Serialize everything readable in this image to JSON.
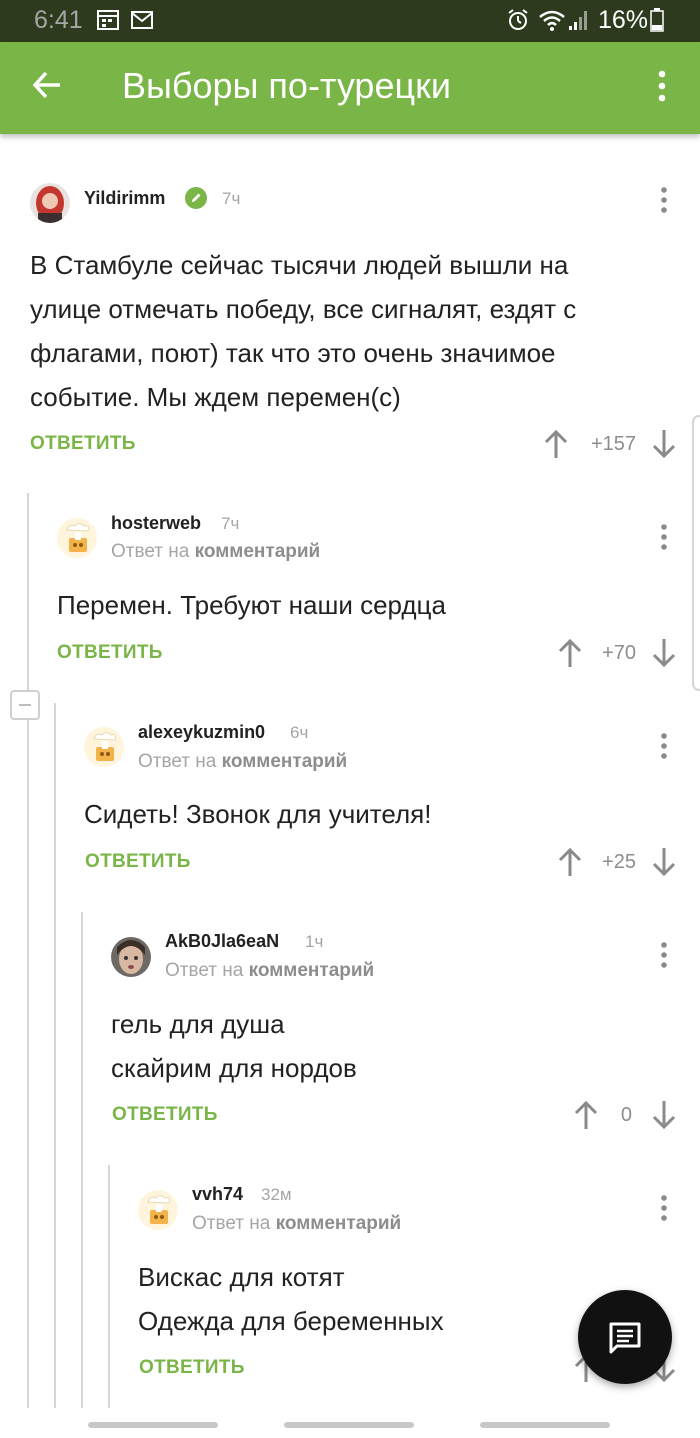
{
  "status_bar": {
    "time": "6:41",
    "battery": "16%"
  },
  "app_bar": {
    "title": "Выборы по-турецки"
  },
  "comments": [
    {
      "author": "Yildirimm",
      "time": "7ч",
      "verified": true,
      "reply_to": null,
      "text": [
        "В Стамбуле сейчас тысячи людей вышли на",
        "улице отмечать победу, все сигналят, ездят с",
        "флагами, поют) так что это очень значимое",
        "событие. Мы ждем перемен(с)"
      ],
      "reply_label": "ОТВЕТИТЬ",
      "score": "+157"
    },
    {
      "author": "hosterweb",
      "time": "7ч",
      "reply_prefix": "Ответ на",
      "reply_target": "комментарий",
      "text": [
        "Перемен. Требуют наши сердца"
      ],
      "reply_label": "ОТВЕТИТЬ",
      "score": "+70"
    },
    {
      "author": "alexeykuzmin0",
      "time": "6ч",
      "reply_prefix": "Ответ на",
      "reply_target": "комментарий",
      "text": [
        "Сидеть! Звонок для учителя!"
      ],
      "reply_label": "ОТВЕТИТЬ",
      "score": "+25"
    },
    {
      "author": "AkB0Jla6eaN",
      "time": "1ч",
      "reply_prefix": "Ответ на",
      "reply_target": "комментарий",
      "text": [
        "гель для душа",
        "скайрим для нордов"
      ],
      "reply_label": "ОТВЕТИТЬ",
      "score": "0"
    },
    {
      "author": "vvh74",
      "time": "32м",
      "reply_prefix": "Ответ на",
      "reply_target": "комментарий",
      "text": [
        "Вискас для котят",
        "Одежда для беременных"
      ],
      "reply_label": "ОТВЕТИТЬ",
      "score": ""
    }
  ],
  "colors": {
    "accent": "#7ab547",
    "status_bar": "#2e3a1d",
    "meta_text": "#a5a5a5"
  },
  "icons": [
    "back-arrow-icon",
    "overflow-menu-icon",
    "verified-pencil-icon",
    "upvote-arrow-icon",
    "downvote-arrow-icon",
    "comment-fab-icon"
  ]
}
